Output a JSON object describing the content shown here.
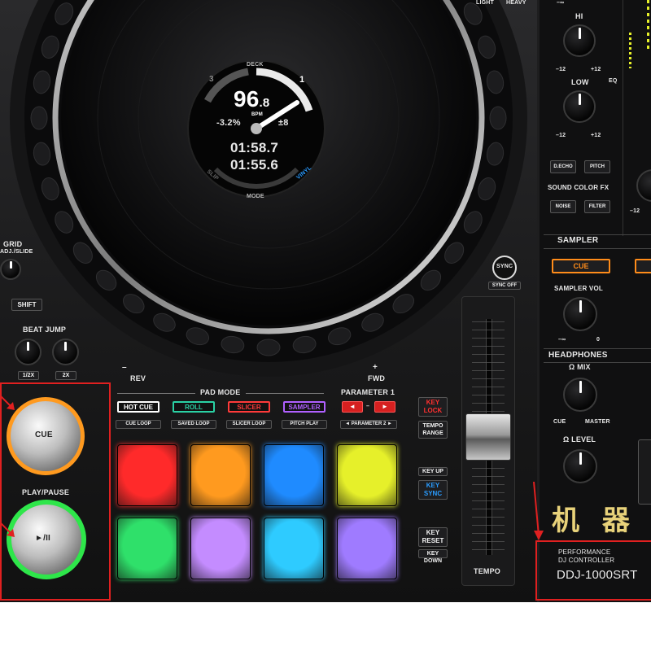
{
  "jog": {
    "deck_label": "DECK",
    "deck_num_left": "3",
    "deck_num_right": "1",
    "bpm_int": "96",
    "bpm_dec": ".8",
    "bpm_unit": "BPM",
    "tempo_pct": "-3.2%",
    "tempo_range": "±8",
    "time1": "01:58.7",
    "time2": "01:55.6",
    "slip": "SLIP",
    "mode": "MODE",
    "vinyl": "VINYL"
  },
  "left": {
    "grid_label": "GRID",
    "grid_sub": "ADJ./SLIDE",
    "shift": "SHIFT",
    "beat_jump": "BEAT JUMP",
    "half": "1/2X",
    "double": "2X",
    "cue_label": "CUE",
    "play_pause": "PLAY/PAUSE",
    "play_glyph": "►/II"
  },
  "transport": {
    "rev": "REV",
    "fwd": "FWD",
    "minus": "–",
    "plus": "+"
  },
  "pad_mode": {
    "title": "PAD MODE",
    "buttons": [
      {
        "label": "HOT CUE",
        "sub": "CUE LOOP",
        "color": "#ffffff"
      },
      {
        "label": "ROLL",
        "sub": "SAVED LOOP",
        "color": "#2ad1a4"
      },
      {
        "label": "SLICER",
        "sub": "SLICER LOOP",
        "color": "#ff3a3a"
      },
      {
        "label": "SAMPLER",
        "sub": "PITCH PLAY",
        "color": "#b060ff"
      }
    ],
    "parameter1": "PARAMETER 1",
    "parameter2": "◄ PARAMETER 2 ►",
    "param_left": "◄",
    "param_right": "►",
    "pads_row1": [
      "#ff2a2a",
      "#ff9a1f",
      "#1f8bff",
      "#e6f02a"
    ],
    "pads_row2": [
      "#2fe06a",
      "#c48cff",
      "#2ecbff",
      "#9f7bff"
    ]
  },
  "key": {
    "key_lock": "KEY LOCK",
    "tempo_range": "TEMPO RANGE",
    "key_up": "KEY UP",
    "key_sync": "KEY SYNC",
    "key_reset": "KEY RESET",
    "key_down": "KEY DOWN"
  },
  "tempo": {
    "sync": "SYNC",
    "sync_off": "SYNC OFF",
    "label": "TEMPO"
  },
  "mixer": {
    "light": "LIGHT",
    "heavy": "HEAVY",
    "neg_inf_top": "–∞",
    "hi": "HI",
    "low": "LOW",
    "eq": "EQ",
    "minus12": "–12",
    "plus12": "+12",
    "sc_echo": "D.ECHO",
    "sc_pitch": "PITCH",
    "sound_color_fx": "SOUND COLOR FX",
    "sc_noise": "NOISE",
    "sc_filter": "FILTER",
    "sampler": "SAMPLER",
    "sampler_cue": "CUE",
    "sampler_vol": "SAMPLER VOL",
    "neg_inf": "–∞",
    "zero": "0",
    "headphones": "HEADPHONES",
    "mix": "MIX",
    "hp_cue": "CUE",
    "hp_master": "MASTER",
    "level": "LEVEL"
  },
  "brand": {
    "performance": "PERFORMANCE",
    "dj_controller": "DJ CONTROLLER",
    "model": "DDJ-1000SRT",
    "watermark": "机 器"
  },
  "colors": {
    "cue_ring": "#ff9a1f",
    "play_ring": "#2ee64a",
    "annotation": "#e02020",
    "sampler_cue": "#ff8c1a"
  }
}
